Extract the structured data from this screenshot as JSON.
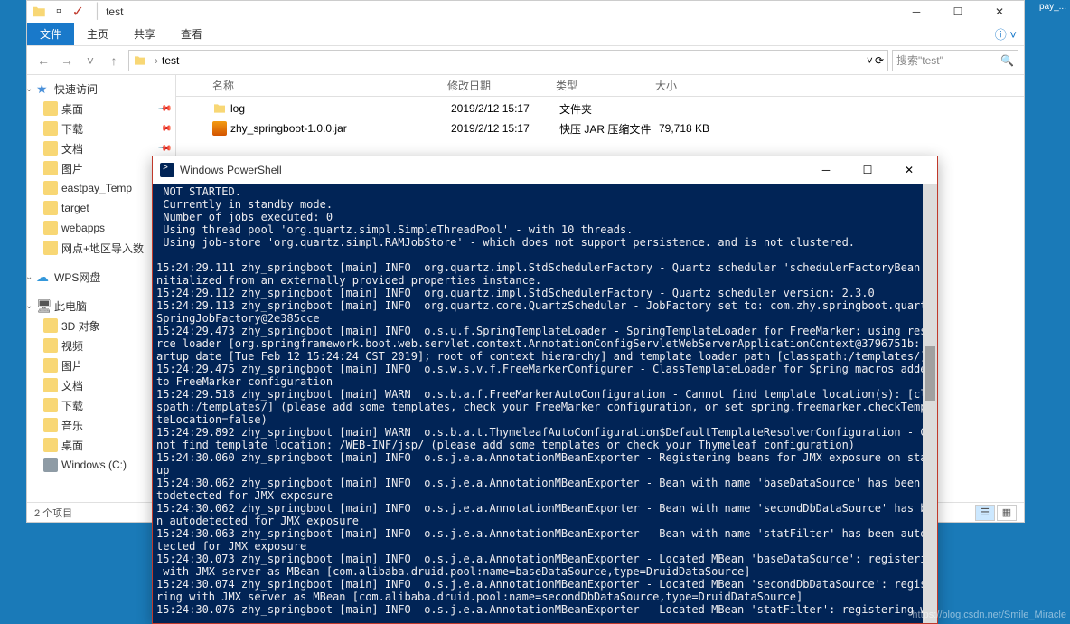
{
  "explorer": {
    "title": "test",
    "tabs": {
      "file": "文件",
      "home": "主页",
      "share": "共享",
      "view": "查看"
    },
    "breadcrumb": {
      "root": "",
      "folder": "test"
    },
    "search_placeholder": "搜索\"test\"",
    "columns": {
      "name": "名称",
      "date": "修改日期",
      "type": "类型",
      "size": "大小"
    },
    "rows": [
      {
        "name": "log",
        "date": "2019/2/12 15:17",
        "type": "文件夹",
        "size": ""
      },
      {
        "name": "zhy_springboot-1.0.0.jar",
        "date": "2019/2/12 15:17",
        "type": "快压 JAR 压缩文件",
        "size": "79,718 KB"
      }
    ],
    "status": "2 个项目",
    "sidebar": {
      "quick": "快速访问",
      "items": [
        "桌面",
        "下载",
        "文档",
        "图片",
        "eastpay_Temp",
        "target",
        "webapps",
        "网点+地区导入数"
      ],
      "wps": "WPS网盘",
      "thispc": "此电脑",
      "pcitems": [
        "3D 对象",
        "视频",
        "图片",
        "文档",
        "下载",
        "音乐",
        "桌面",
        "Windows (C:)"
      ]
    }
  },
  "powershell": {
    "title": "Windows PowerShell",
    "console": " NOT STARTED.\n Currently in standby mode.\n Number of jobs executed: 0\n Using thread pool 'org.quartz.simpl.SimpleThreadPool' - with 10 threads.\n Using job-store 'org.quartz.simpl.RAMJobStore' - which does not support persistence. and is not clustered.\n\n15:24:29.111 zhy_springboot [main] INFO  org.quartz.impl.StdSchedulerFactory - Quartz scheduler 'schedulerFactoryBean' i\nnitialized from an externally provided properties instance.\n15:24:29.112 zhy_springboot [main] INFO  org.quartz.impl.StdSchedulerFactory - Quartz scheduler version: 2.3.0\n15:24:29.113 zhy_springboot [main] INFO  org.quartz.core.QuartzScheduler - JobFactory set to: com.zhy.springboot.quartz.\nSpringJobFactory@2e385cce\n15:24:29.473 zhy_springboot [main] INFO  o.s.u.f.SpringTemplateLoader - SpringTemplateLoader for FreeMarker: using resou\nrce loader [org.springframework.boot.web.servlet.context.AnnotationConfigServletWebServerApplicationContext@3796751b: st\nartup date [Tue Feb 12 15:24:24 CST 2019]; root of context hierarchy] and template loader path [classpath:/templates/]\n15:24:29.475 zhy_springboot [main] INFO  o.s.w.s.v.f.FreeMarkerConfigurer - ClassTemplateLoader for Spring macros added\nto FreeMarker configuration\n15:24:29.518 zhy_springboot [main] WARN  o.s.b.a.f.FreeMarkerAutoConfiguration - Cannot find template location(s): [clas\nspath:/templates/] (please add some templates, check your FreeMarker configuration, or set spring.freemarker.checkTempla\nteLocation=false)\n15:24:29.892 zhy_springboot [main] WARN  o.s.b.a.t.ThymeleafAutoConfiguration$DefaultTemplateResolverConfiguration - Can\nnot find template location: /WEB-INF/jsp/ (please add some templates or check your Thymeleaf configuration)\n15:24:30.060 zhy_springboot [main] INFO  o.s.j.e.a.AnnotationMBeanExporter - Registering beans for JMX exposure on start\nup\n15:24:30.062 zhy_springboot [main] INFO  o.s.j.e.a.AnnotationMBeanExporter - Bean with name 'baseDataSource' has been au\ntodetected for JMX exposure\n15:24:30.062 zhy_springboot [main] INFO  o.s.j.e.a.AnnotationMBeanExporter - Bean with name 'secondDbDataSource' has bee\nn autodetected for JMX exposure\n15:24:30.063 zhy_springboot [main] INFO  o.s.j.e.a.AnnotationMBeanExporter - Bean with name 'statFilter' has been autode\ntected for JMX exposure\n15:24:30.073 zhy_springboot [main] INFO  o.s.j.e.a.AnnotationMBeanExporter - Located MBean 'baseDataSource': registering\n with JMX server as MBean [com.alibaba.druid.pool:name=baseDataSource,type=DruidDataSource]\n15:24:30.074 zhy_springboot [main] INFO  o.s.j.e.a.AnnotationMBeanExporter - Located MBean 'secondDbDataSource': registe\nring with JMX server as MBean [com.alibaba.druid.pool:name=secondDbDataSource,type=DruidDataSource]\n15:24:30.076 zhy_springboot [main] INFO  o.s.j.e.a.AnnotationMBeanExporter - Located MBean 'statFilter': registering wit"
  },
  "watermark": "https://blog.csdn.net/Smile_Miracle",
  "desktop_right_label": "pay_..."
}
